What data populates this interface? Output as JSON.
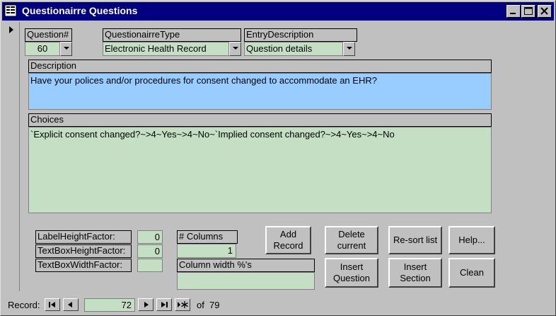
{
  "window": {
    "title": "Questionairre Questions",
    "controls": [
      "minimize",
      "maximize",
      "close"
    ]
  },
  "form": {
    "question_label": "Question#",
    "question_value": "60",
    "type_label": "QuestionairreType",
    "type_value": "Electronic Health Record",
    "entry_label": "EntryDescription",
    "entry_value": "Question details",
    "description_label": "Description",
    "description_value": "Have your polices and/or procedures for consent changed to accommodate an EHR?",
    "choices_label": "Choices",
    "choices_value": "`Explicit consent changed?~>4~Yes~>4~No~`Implied consent changed?~>4~Yes~>4~No",
    "label_height_label": "LabelHeightFactor:",
    "label_height_value": "0",
    "textbox_height_label": "TextBoxHeightFactor:",
    "textbox_height_value": "0",
    "textbox_width_label": "TextBoxWidthFactor:",
    "textbox_width_value": "",
    "columns_label": "# Columns",
    "columns_value": "1",
    "colwidth_label": "Column width %'s",
    "colwidth_value": ""
  },
  "buttons": {
    "add_record": "Add\nRecord",
    "delete_current": "Delete\ncurrent",
    "resort_list": "Re-sort list",
    "help": "Help...",
    "insert_question": "Insert\nQuestion",
    "insert_section": "Insert\nSection",
    "clean": "Clean"
  },
  "navigation": {
    "record_label": "Record:",
    "current": "72",
    "of_label": "of",
    "total": "79"
  },
  "colors": {
    "titlebar": "#000080",
    "field_green": "#c4dfc4",
    "field_blue": "#99ccff",
    "face": "#c0c0c0"
  }
}
